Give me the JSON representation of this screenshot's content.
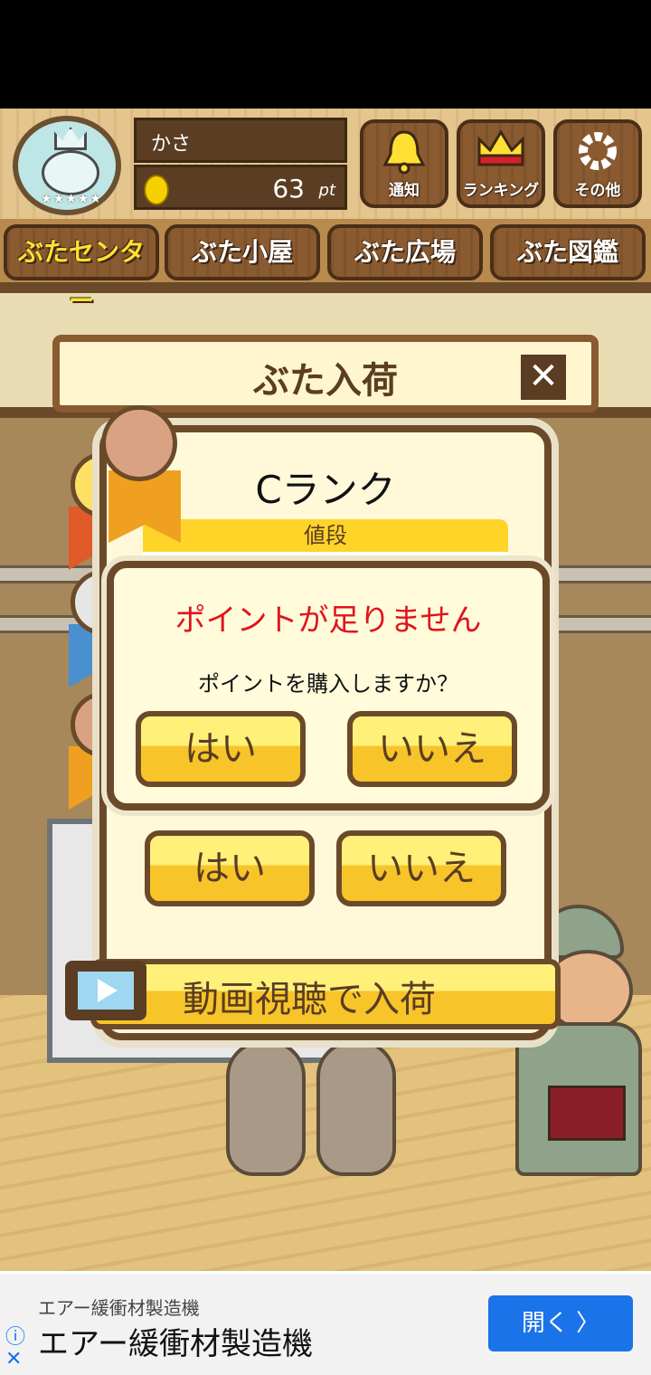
{
  "header": {
    "player_name": "かさ",
    "points_value": "63",
    "points_unit": "pt",
    "avatar_stars": "★★★★★",
    "buttons": [
      {
        "label": "通知",
        "icon": "bell-icon"
      },
      {
        "label": "ランキング",
        "icon": "crown-icon"
      },
      {
        "label": "その他",
        "icon": "gear-icon"
      }
    ]
  },
  "tabs": [
    {
      "label": "ぶたセンター",
      "active": true
    },
    {
      "label": "ぶた小屋",
      "active": false
    },
    {
      "label": "ぶた広場",
      "active": false
    },
    {
      "label": "ぶた図鑑",
      "active": false
    }
  ],
  "panel": {
    "title": "ぶた入荷",
    "close_symbol": "✕",
    "rank_title": "Cランク",
    "price_label": "値段",
    "yes_label": "はい",
    "no_label": "いいえ",
    "video_button_label": "動画視聴で入荷"
  },
  "dialog": {
    "title": "ポイントが足りません",
    "message": "ポイントを購入しますか？",
    "yes_label": "はい",
    "no_label": "いいえ"
  },
  "ad": {
    "headline_small": "エアー緩衝材製造機",
    "headline_large": "エアー緩衝材製造機",
    "open_label": "開く",
    "open_arrow": "〉",
    "info_symbol": "ⓘ",
    "close_symbol": "✕"
  },
  "colors": {
    "accent_yellow": "#ffd429",
    "wood_dark": "#6b4a2a",
    "alert_red": "#e0141c",
    "ad_button_blue": "#1a73e8"
  }
}
